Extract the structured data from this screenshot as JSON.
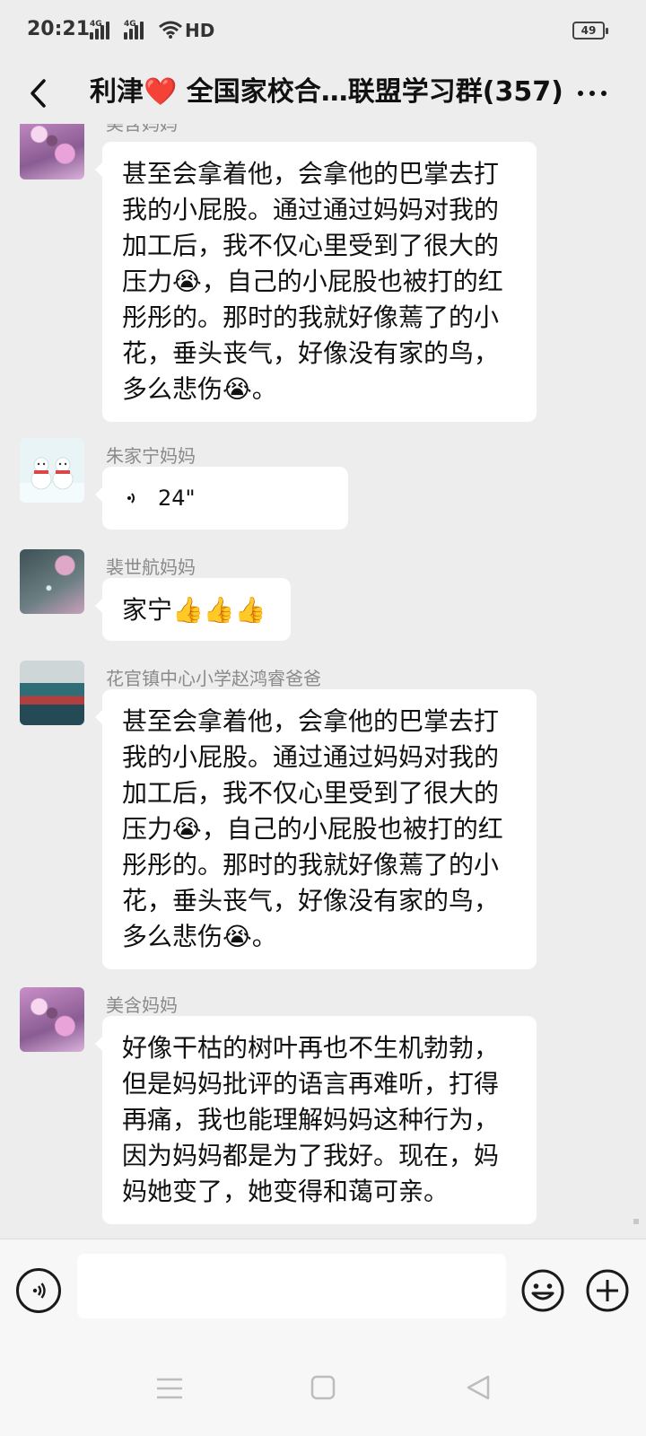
{
  "status_bar": {
    "time": "20:21",
    "signal1": "4G",
    "signal2": "4G",
    "hd": "HD",
    "battery": "49"
  },
  "header": {
    "title": "利津❤️ 全国家校合…联盟学习群(357)",
    "back_icon": "chevron-left-icon",
    "more_icon": "more-dots-icon"
  },
  "messages": [
    {
      "sender": "美含妈妈",
      "avatar": "flower",
      "text": "甚至会拿着他，会拿他的巴掌去打我的小屁股。通过通过妈妈对我的加工后，我不仅心里受到了很大的压力😭，自己的小屁股也被打的红彤彤的。那时的我就好像蔫了的小花，垂头丧气，好像没有家的鸟，多么悲伤😭。"
    },
    {
      "sender": "朱家宁妈妈",
      "avatar": "snowmen",
      "voice_duration": "24\""
    },
    {
      "sender": "裴世航妈妈",
      "avatar": "night",
      "text": "家宁👍👍👍"
    },
    {
      "sender": "花官镇中心小学赵鸿睿爸爸",
      "avatar": "classroom",
      "text": "甚至会拿着他，会拿他的巴掌去打我的小屁股。通过通过妈妈对我的加工后，我不仅心里受到了很大的压力😭，自己的小屁股也被打的红彤彤的。那时的我就好像蔫了的小花，垂头丧气，好像没有家的鸟，多么悲伤😭。"
    },
    {
      "sender": "美含妈妈",
      "avatar": "flower",
      "text": "好像干枯的树叶再也不生机勃勃，但是妈妈批评的语言再难听，打得再痛，我也能理解妈妈这种行为，因为妈妈都是为了我好。现在，妈妈她变了，她变得和蔼可亲。"
    }
  ],
  "input_bar": {
    "voice_icon": "voice-mode-icon",
    "placeholder": "",
    "emoji_icon": "emoji-icon",
    "plus_icon": "plus-icon"
  },
  "nav_bar": {
    "menu_icon": "menu-icon",
    "home_icon": "home-icon",
    "back_icon": "back-triangle-icon"
  },
  "colors": {
    "background": "#ededed",
    "bubble": "#ffffff",
    "sender_text": "#8a8a8a"
  }
}
